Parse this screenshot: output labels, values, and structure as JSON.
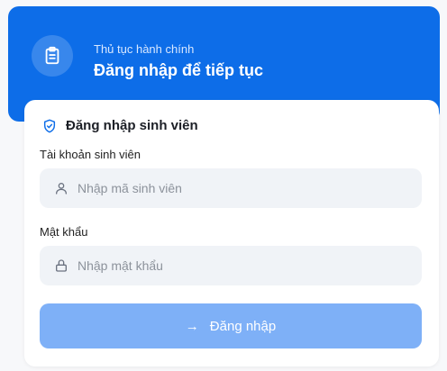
{
  "colors": {
    "brand": "#0d6de8",
    "button": "#7eb0f7",
    "input_bg": "#f0f3f7"
  },
  "header": {
    "icon": "clipboard-icon",
    "subtitle": "Thủ tục hành chính",
    "title": "Đăng nhập để tiếp tục"
  },
  "login": {
    "icon": "shield-check-icon",
    "title": "Đăng nhập sinh viên",
    "username": {
      "label": "Tài khoản sinh viên",
      "icon": "user-icon",
      "placeholder": "Nhập mã sinh viên"
    },
    "password": {
      "label": "Mật khẩu",
      "icon": "lock-icon",
      "placeholder": "Nhập mật khẩu"
    },
    "submit": {
      "icon": "arrow-right-icon",
      "arrow": "→",
      "label": "Đăng nhập"
    }
  }
}
